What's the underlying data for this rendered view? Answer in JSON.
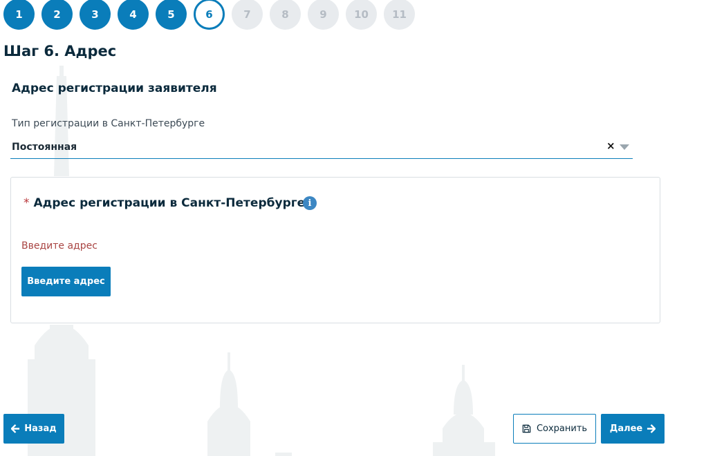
{
  "stepper": {
    "steps": [
      {
        "label": "1",
        "state": "done"
      },
      {
        "label": "2",
        "state": "done"
      },
      {
        "label": "3",
        "state": "done"
      },
      {
        "label": "4",
        "state": "done"
      },
      {
        "label": "5",
        "state": "done"
      },
      {
        "label": "6",
        "state": "current"
      },
      {
        "label": "7",
        "state": "todo"
      },
      {
        "label": "8",
        "state": "todo"
      },
      {
        "label": "9",
        "state": "todo"
      },
      {
        "label": "10",
        "state": "todo"
      },
      {
        "label": "11",
        "state": "todo"
      }
    ]
  },
  "page": {
    "title": "Шаг 6. Адрес",
    "section_title": "Адрес регистрации заявителя"
  },
  "registration_type": {
    "label": "Тип регистрации в Санкт-Петербурге",
    "value": "Постоянная",
    "clear_icon": "×"
  },
  "address_card": {
    "required_mark": "*",
    "title": "Адрес регистрации в Санкт-Петербурге",
    "info_icon": "i",
    "error": "Введите адрес",
    "button_label": "Введите адрес"
  },
  "footer": {
    "back_label": "Назад",
    "save_label": "Сохранить",
    "next_label": "Далее"
  },
  "colors": {
    "accent": "#0a7dba",
    "error": "#a94442",
    "heading": "#0b2a3c"
  },
  "icons": {
    "back": "arrow-left-icon",
    "save": "floppy-disk-icon",
    "next": "arrow-right-icon",
    "info": "info-circle-icon"
  }
}
